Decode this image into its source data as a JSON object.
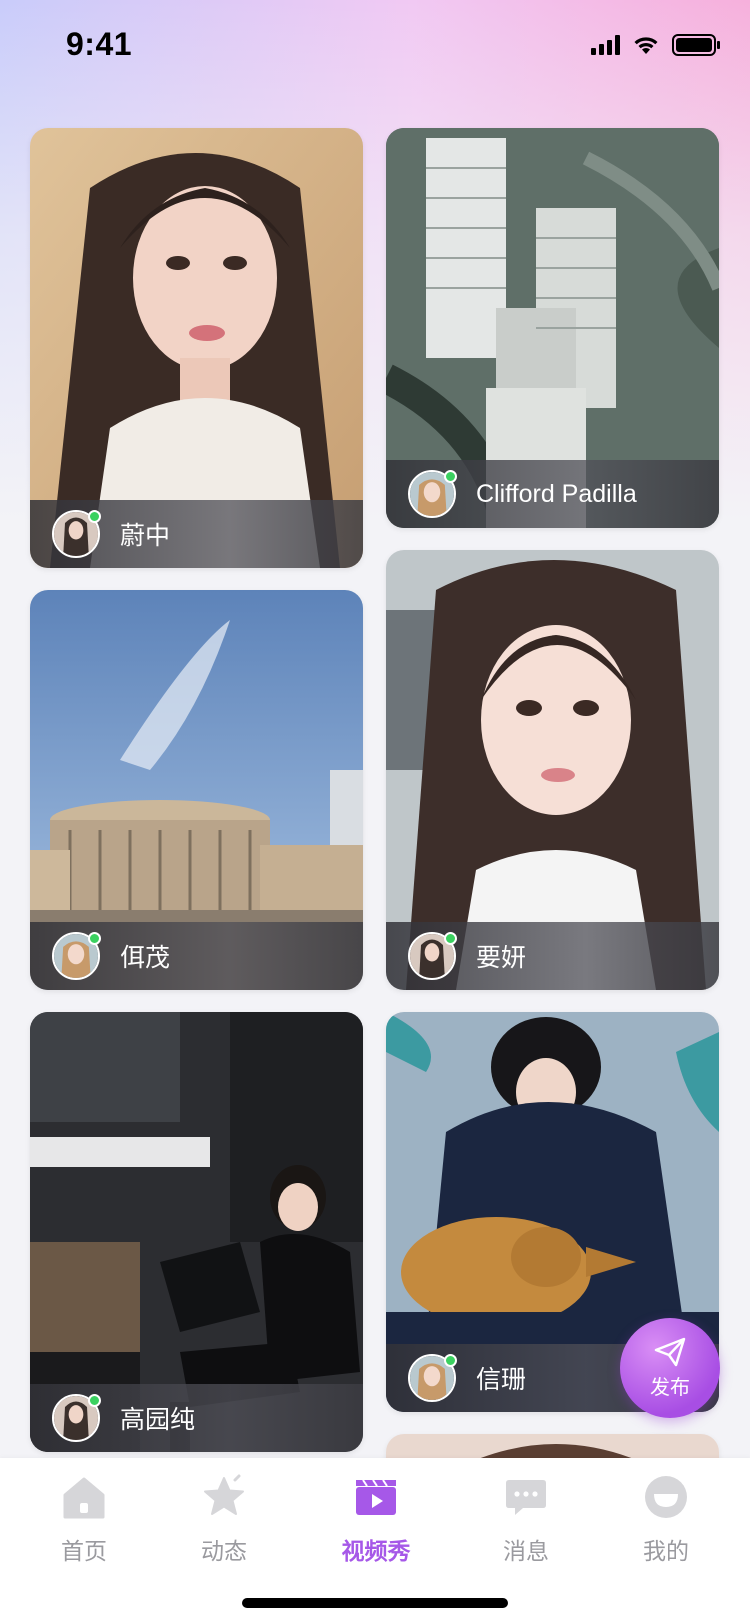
{
  "status_bar": {
    "time": "9:41"
  },
  "feed": {
    "cards": [
      {
        "name": "蔚中",
        "online": true
      },
      {
        "name": "Clifford Padilla",
        "online": true
      },
      {
        "name": "佴茂",
        "online": true
      },
      {
        "name": "要妍",
        "online": true
      },
      {
        "name": "高园纯",
        "online": true
      },
      {
        "name": "信珊",
        "online": true
      }
    ]
  },
  "publish_button": {
    "label": "发布",
    "icon": "paper-plane-icon"
  },
  "tab_bar": {
    "tabs": [
      {
        "label": "首页",
        "icon": "home-icon",
        "active": false
      },
      {
        "label": "动态",
        "icon": "star-icon",
        "active": false
      },
      {
        "label": "视频秀",
        "icon": "video-icon",
        "active": true
      },
      {
        "label": "消息",
        "icon": "chat-icon",
        "active": false
      },
      {
        "label": "我的",
        "icon": "profile-icon",
        "active": false
      }
    ]
  },
  "colors": {
    "accent": "#a658e8",
    "online": "#3bd160",
    "inactive": "#9a9a9f"
  }
}
